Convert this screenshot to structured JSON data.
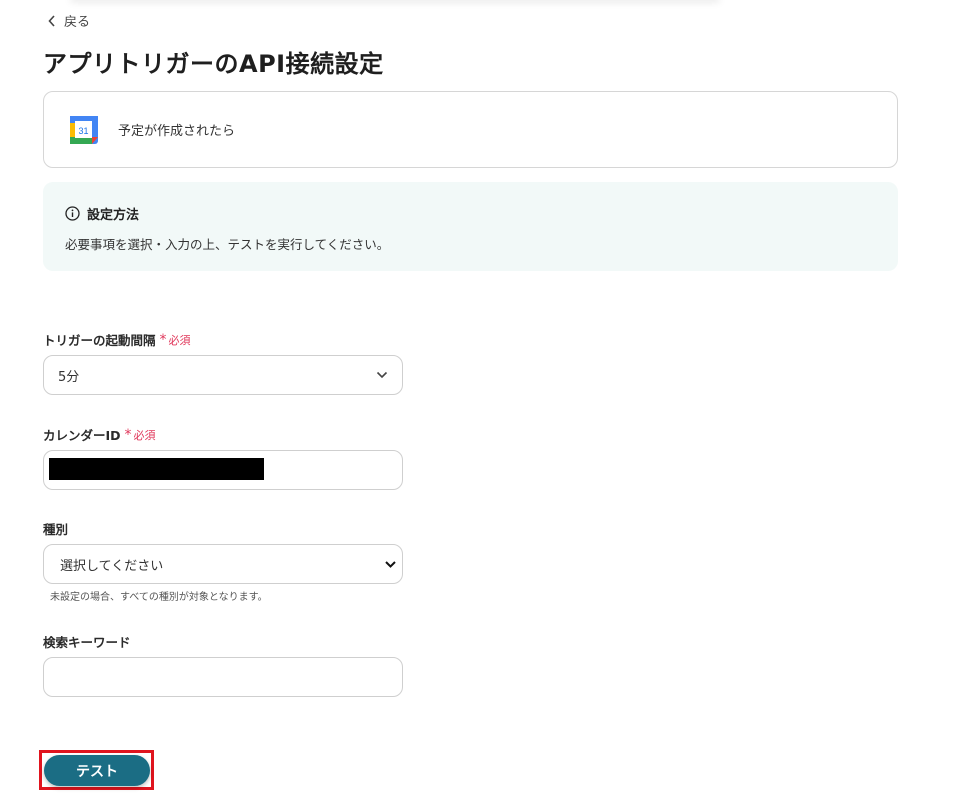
{
  "nav": {
    "back_label": "戻る"
  },
  "page": {
    "title": "アプリトリガーのAPI接続設定"
  },
  "trigger": {
    "icon": "google-calendar-icon",
    "icon_text": "31",
    "label": "予定が作成されたら"
  },
  "info": {
    "heading": "設定方法",
    "body": "必要事項を選択・入力の上、テストを実行してください。"
  },
  "required_label": "必須",
  "required_mark": "*",
  "fields": {
    "interval": {
      "label": "トリガーの起動間隔",
      "value": "5分"
    },
    "calendar_id": {
      "label": "カレンダーID",
      "value": ""
    },
    "type": {
      "label": "種別",
      "placeholder": "選択してください",
      "hint": "未設定の場合、すべての種別が対象となります。"
    },
    "keyword": {
      "label": "検索キーワード",
      "value": ""
    }
  },
  "actions": {
    "test_label": "テスト"
  },
  "colors": {
    "accent": "#1b6d84",
    "required": "#e0375a",
    "info_bg": "#f2f9f8",
    "highlight": "#e0141e"
  }
}
